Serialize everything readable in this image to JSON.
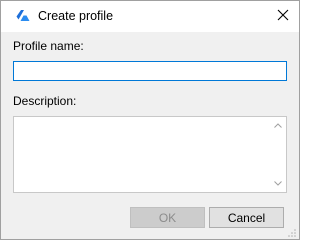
{
  "window": {
    "title": "Create profile",
    "icon": "app-logo-icon",
    "close_icon": "close-icon"
  },
  "form": {
    "profile_name": {
      "label": "Profile name:",
      "value": "",
      "placeholder": ""
    },
    "description": {
      "label": "Description:",
      "value": "",
      "placeholder": ""
    }
  },
  "buttons": {
    "ok_label": "OK",
    "ok_enabled": false,
    "cancel_label": "Cancel"
  },
  "colors": {
    "accent": "#0078d7",
    "dialog_bg": "#f0f0f0",
    "disabled_text": "#8c8c8c"
  }
}
